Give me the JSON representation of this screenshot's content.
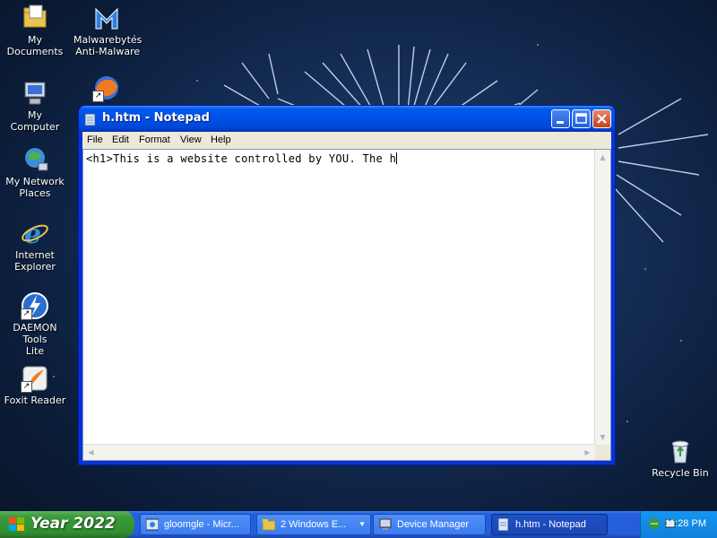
{
  "desktop": {
    "icons": [
      {
        "label": "My Documents",
        "icon": "folder-icon"
      },
      {
        "label": "Malwarebytes Anti-Malware",
        "line1": "Malwarebytes",
        "line2": "Anti-Malware",
        "icon": "malwarebytes-icon"
      },
      {
        "label": "My Computer",
        "icon": "computer-icon"
      },
      {
        "label": "Firefox",
        "icon": "firefox-icon"
      },
      {
        "label": "My Network Places",
        "line1": "My Network",
        "line2": "Places",
        "icon": "network-places-icon"
      },
      {
        "label": "Internet Explorer",
        "line1": "Internet",
        "line2": "Explorer",
        "icon": "internet-explorer-icon"
      },
      {
        "label": "DAEMON Tools Lite",
        "line1": "DAEMON Tools",
        "line2": "Lite",
        "icon": "daemon-tools-icon"
      },
      {
        "label": "Foxit Reader",
        "icon": "foxit-reader-icon"
      },
      {
        "label": "Recycle Bin",
        "icon": "recycle-bin-icon"
      }
    ]
  },
  "notepad": {
    "title": "h.htm - Notepad",
    "menu": [
      "File",
      "Edit",
      "Format",
      "View",
      "Help"
    ],
    "content": "<h1>This is a website controlled by YOU. The h"
  },
  "taskbar": {
    "start_label": "Year 2022",
    "tasks": [
      {
        "label": "gloomgle - Micr...",
        "icon": "browser-icon",
        "active": false
      },
      {
        "label": "2 Windows E...",
        "icon": "folder-icon",
        "active": false
      },
      {
        "label": "Device Manager",
        "icon": "device-manager-icon",
        "active": false
      },
      {
        "label": "h.htm - Notepad",
        "icon": "notepad-icon",
        "active": true
      }
    ],
    "clock": "11:28 PM"
  },
  "colors": {
    "titlebar": "#0054e3",
    "taskbar": "#245edb",
    "start": "#3c9b3c",
    "tray": "#0f7fdc"
  }
}
